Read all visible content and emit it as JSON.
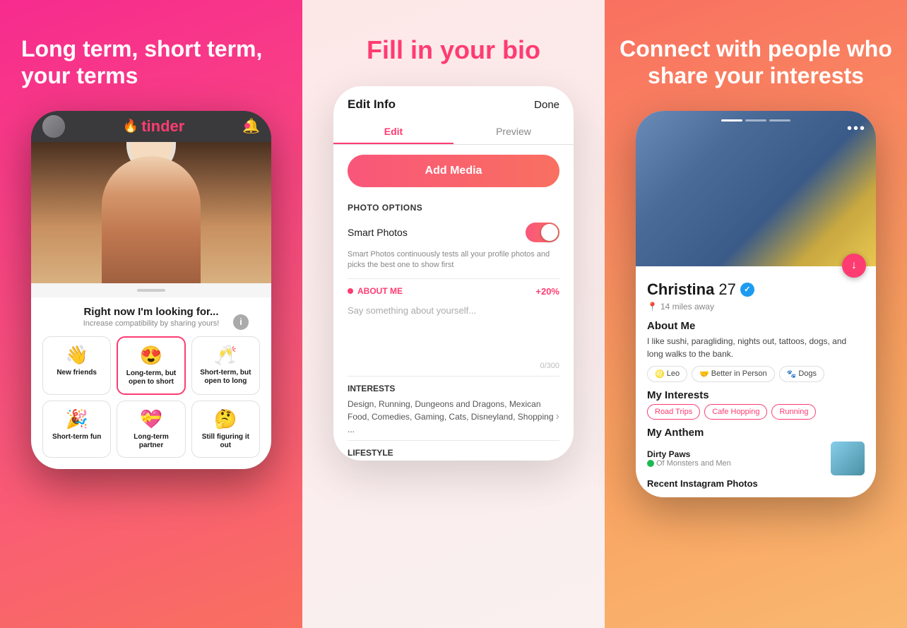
{
  "panel1": {
    "title": "Long term, short term,\nyour terms",
    "phone": {
      "logo": "tinder",
      "flame": "🔥",
      "heading": "Right now I'm looking for...",
      "subheading": "Increase compatibility by sharing yours!",
      "options": [
        {
          "id": "new-friends",
          "emoji": "👋",
          "label": "New friends",
          "selected": false
        },
        {
          "id": "long-term-open",
          "emoji": "😍",
          "label": "Long-term, but open to short",
          "selected": true
        },
        {
          "id": "short-term-open",
          "emoji": "🥂",
          "label": "Short-term, but open to long",
          "selected": false
        },
        {
          "id": "short-term-fun",
          "emoji": "🎉",
          "label": "Short-term fun",
          "selected": false
        },
        {
          "id": "long-term-partner",
          "emoji": "💝",
          "label": "Long-term partner",
          "selected": false
        },
        {
          "id": "still-figuring",
          "emoji": "🤔",
          "label": "Still figuring it out",
          "selected": false
        }
      ]
    }
  },
  "panel2": {
    "title": "Fill in your bio",
    "phone": {
      "header_title": "Edit Info",
      "done_label": "Done",
      "tab_edit": "Edit",
      "tab_preview": "Preview",
      "add_media_label": "Add Media",
      "photo_options_label": "PHOTO OPTIONS",
      "smart_photos_label": "Smart Photos",
      "smart_photos_desc": "Smart Photos continuously tests all your profile photos and picks the best one to show first",
      "about_me_label": "ABOUT ME",
      "about_me_percent": "+20%",
      "about_me_placeholder": "Say something about yourself...",
      "char_count": "0/300",
      "interests_label": "INTERESTS",
      "interests_text": "Design, Running, Dungeons and Dragons, Mexican Food, Comedies, Gaming, Cats, Disneyland, Shopping ...",
      "lifestyle_label": "LIFESTYLE"
    }
  },
  "panel3": {
    "title": "Connect with people who share your interests",
    "phone": {
      "name": "Christina",
      "age": "27",
      "distance": "14 miles away",
      "about_me_title": "About Me",
      "about_me_text": "I like sushi, paragliding, nights out, tattoos, dogs, and long walks to the bank.",
      "tags": [
        {
          "icon": "♌",
          "label": "Leo"
        },
        {
          "icon": "🤝",
          "label": "Better in Person"
        },
        {
          "icon": "🐾",
          "label": "Dogs"
        }
      ],
      "interests_title": "My Interests",
      "interests": [
        "Road Trips",
        "Cafe Hopping",
        "Running"
      ],
      "anthem_title": "My Anthem",
      "anthem_song": "Dirty Paws",
      "anthem_artist": "Of Monsters and Men",
      "recent_photos_label": "Recent Instagram Photos",
      "three_dots": "•••"
    }
  }
}
